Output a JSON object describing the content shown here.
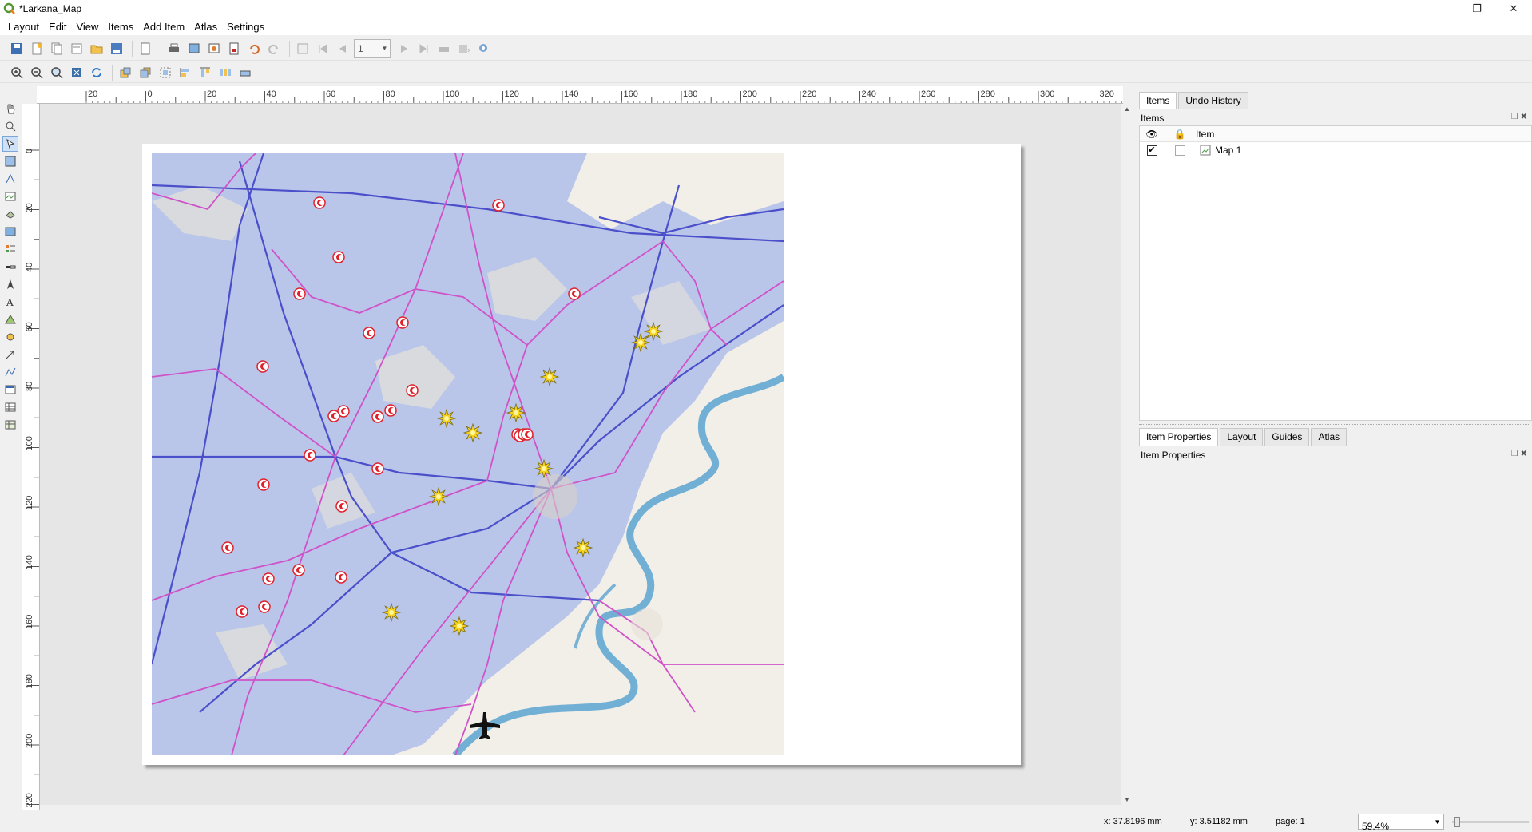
{
  "window": {
    "title": "*Larkana_Map"
  },
  "menu": [
    "Layout",
    "Edit",
    "View",
    "Items",
    "Add Item",
    "Atlas",
    "Settings"
  ],
  "toolbar": {
    "page_number": "1"
  },
  "ruler_h_labels": [
    "20",
    "0",
    "20",
    "40",
    "60",
    "80",
    "100",
    "120",
    "140",
    "160",
    "180",
    "200",
    "220",
    "240",
    "260",
    "280",
    "300",
    "320"
  ],
  "ruler_v_labels": [
    "0",
    "20",
    "40",
    "60",
    "80",
    "100",
    "120",
    "140",
    "160",
    "180",
    "200",
    "220"
  ],
  "items_panel": {
    "tabs": [
      "Items",
      "Undo History"
    ],
    "title": "Items",
    "column_item": "Item",
    "items": [
      {
        "name": "Map 1",
        "visible": true,
        "locked": false
      }
    ]
  },
  "properties_panel": {
    "tabs": [
      "Item Properties",
      "Layout",
      "Guides",
      "Atlas"
    ],
    "title": "Item Properties"
  },
  "status": {
    "x": "x: 37.8196 mm",
    "y": "y: 3.51182 mm",
    "page": "page: 1",
    "zoom": "59.4%"
  },
  "colors": {
    "flood": "#b9c6ea",
    "road_blue": "#4b4fc9",
    "road_pink": "#d052c8",
    "river": "#5ba3d0",
    "marker_red": "#e0202a",
    "marker_yellow": "#f6d21c"
  }
}
